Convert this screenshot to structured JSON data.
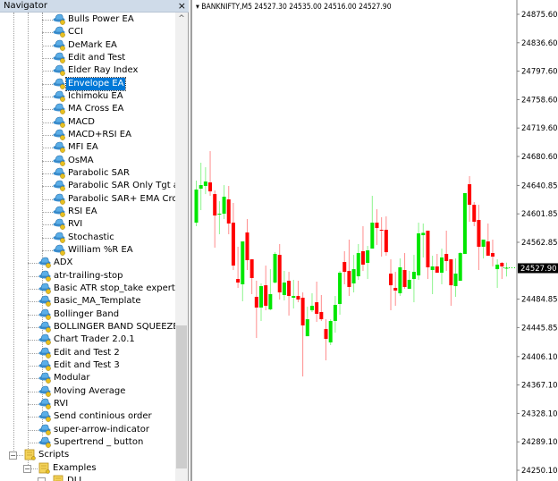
{
  "navigator": {
    "title": "Navigator",
    "close": "×",
    "scroll_up": "^",
    "scroll_position": 0.85,
    "deep_items": [
      "Bulls Power EA",
      "CCI",
      "DeMark EA",
      "Edit and Test",
      "Elder Ray Index",
      "Envelope EA",
      "Ichimoku EA",
      "MA Cross EA",
      "MACD",
      "MACD+RSI EA",
      "MFI EA",
      "OsMA",
      "Parabolic SAR",
      "Parabolic SAR Only Tgt and",
      "Parabolic SAR+ EMA Cross",
      "RSI EA",
      "RVI",
      "Stochastic",
      "William %R EA"
    ],
    "selected": "Envelope EA",
    "items": [
      "ADX",
      "atr-trailing-stop",
      "Basic ATR stop_take expert advi",
      "Basic_MA_Template",
      "Bollinger Band",
      "BOLLINGER BAND SQUEEZE",
      "Chart Trader 2.0.1",
      "Edit and Test 2",
      "Edit and Test 3",
      "Modular",
      "Moving Average",
      "RVI",
      "Send continious order",
      "super-arrow-indicator",
      "Supertrend _ button"
    ],
    "folders": [
      {
        "label": "Scripts",
        "icon": "scroll-icon"
      },
      {
        "label": "Examples",
        "icon": "scroll-icon"
      },
      {
        "label": "DLL",
        "icon": "scroll-icon"
      }
    ],
    "item_icon": "expert-advisor-hat-icon"
  },
  "chart": {
    "header": "BANKNIFTY,M5  24527.30 24535.00 24516.00 24527.90",
    "bull_color": "#00e600",
    "bear_color": "#ff0000",
    "last_price_label": "24527.90"
  },
  "chart_data": {
    "type": "candlestick",
    "symbol": "BANKNIFTY",
    "timeframe": "M5",
    "ylim": [
      24250.1,
      24875.6
    ],
    "y_ticks": [
      "24875.60",
      "24836.60",
      "24797.60",
      "24758.60",
      "24719.60",
      "24680.60",
      "24640.85",
      "24601.85",
      "24562.85",
      "24484.85",
      "24445.85",
      "24406.10",
      "24367.10",
      "24328.10",
      "24289.10",
      "24250.10"
    ],
    "ohlc": [
      [
        24589.8,
        24647.4,
        24584.9,
        24635.2
      ],
      [
        24636.4,
        24672.0,
        24607.0,
        24641.3
      ],
      [
        24640.1,
        24665.8,
        24629.0,
        24646.2
      ],
      [
        24645.0,
        24687.9,
        24626.6,
        24632.7
      ],
      [
        24629.0,
        24634.0,
        24555.5,
        24599.6
      ],
      [
        24600.8,
        24619.2,
        24573.9,
        24602.1
      ],
      [
        24602.1,
        24641.3,
        24594.7,
        24625.4
      ],
      [
        24621.7,
        24640.1,
        24573.9,
        24588.6
      ],
      [
        24589.8,
        24616.8,
        24524.8,
        24530.9
      ],
      [
        24512.5,
        24556.7,
        24500.3,
        24507.6
      ],
      [
        24505.2,
        24564.0,
        24481.9,
        24564.0
      ],
      [
        24576.3,
        24594.7,
        24524.8,
        24538.3
      ],
      [
        24539.5,
        24539.5,
        24491.7,
        24513.8
      ],
      [
        24488.0,
        24510.1,
        24431.6,
        24473.3
      ],
      [
        24473.3,
        24506.4,
        24454.9,
        24502.7
      ],
      [
        24503.9,
        24530.9,
        24469.6,
        24475.7
      ],
      [
        24470.8,
        24526.0,
        24469.6,
        24491.7
      ],
      [
        24507.6,
        24549.3,
        24506.4,
        24546.9
      ],
      [
        24545.6,
        24560.4,
        24484.3,
        24494.1
      ],
      [
        24490.5,
        24523.6,
        24483.1,
        24507.6
      ],
      [
        24510.1,
        24522.3,
        24462.3,
        24489.2
      ],
      [
        24486.8,
        24511.3,
        24472.1,
        24489.2
      ],
      [
        24489.2,
        24510.1,
        24480.6,
        24484.3
      ],
      [
        24486.8,
        24494.1,
        24378.8,
        24448.8
      ],
      [
        24434.0,
        24474.5,
        24434.0,
        24457.3
      ],
      [
        24469.6,
        24492.9,
        24467.2,
        24475.7
      ],
      [
        24480.6,
        24508.9,
        24453.7,
        24464.7
      ],
      [
        24467.2,
        24490.5,
        24454.9,
        24457.3
      ],
      [
        24443.8,
        24457.3,
        24400.9,
        24430.4
      ],
      [
        24425.5,
        24457.3,
        24421.8,
        24454.9
      ],
      [
        24454.9,
        24489.2,
        24438.9,
        24477.0
      ],
      [
        24478.2,
        24523.6,
        24463.5,
        24521.1
      ],
      [
        24535.8,
        24550.6,
        24505.2,
        24522.3
      ],
      [
        24523.6,
        24566.5,
        24489.2,
        24501.5
      ],
      [
        24506.4,
        24545.6,
        24494.1,
        24526.0
      ],
      [
        24516.2,
        24560.4,
        24511.3,
        24548.1
      ],
      [
        24550.6,
        24584.9,
        24523.6,
        24532.2
      ],
      [
        24534.6,
        24557.9,
        24512.5,
        24551.8
      ],
      [
        24554.2,
        24626.6,
        24554.2,
        24589.8
      ],
      [
        24589.8,
        24608.2,
        24559.1,
        24582.4
      ],
      [
        24580.0,
        24597.2,
        24543.2,
        24578.8
      ],
      [
        24580.0,
        24598.4,
        24544.4,
        24549.3
      ],
      [
        24519.9,
        24539.5,
        24469.6,
        24503.9
      ],
      [
        24500.3,
        24522.3,
        24475.7,
        24496.6
      ],
      [
        24492.9,
        24540.7,
        24489.2,
        24528.5
      ],
      [
        24524.8,
        24548.1,
        24499.0,
        24501.5
      ],
      [
        24499.0,
        24523.6,
        24499.0,
        24511.3
      ],
      [
        24512.5,
        24545.6,
        24480.6,
        24522.3
      ],
      [
        24517.4,
        24589.8,
        24511.3,
        24575.1
      ],
      [
        24572.6,
        24588.6,
        24542.0,
        24575.8
      ],
      [
        24578.8,
        24578.8,
        24512.5,
        24528.5
      ],
      [
        24524.8,
        24544.4,
        24491.7,
        24529.7
      ],
      [
        24529.7,
        24546.9,
        24521.1,
        24521.1
      ],
      [
        24521.1,
        24554.2,
        24505.2,
        24542.0
      ],
      [
        24546.9,
        24578.8,
        24523.6,
        24537.1
      ],
      [
        24539.5,
        24539.5,
        24475.7,
        24503.9
      ],
      [
        24502.7,
        24540.7,
        24488.0,
        24519.9
      ],
      [
        24510.1,
        24549.3,
        24510.1,
        24548.1
      ],
      [
        24546.9,
        24630.3,
        24546.9,
        24630.3
      ],
      [
        24642.5,
        24653.6,
        24591.0,
        24614.3
      ],
      [
        24614.3,
        24618.0,
        24584.9,
        24591.0
      ],
      [
        24593.5,
        24614.3,
        24524.8,
        24556.7
      ],
      [
        24556.7,
        24566.5,
        24540.7,
        24566.5
      ],
      [
        24564.0,
        24588.6,
        24544.4,
        24544.4
      ],
      [
        24548.1,
        24566.5,
        24529.7,
        24543.2
      ],
      [
        24526.0,
        24539.5,
        24500.3,
        24532.2
      ],
      [
        24534.6,
        24535.8,
        24512.5,
        24529.7
      ],
      [
        24527.3,
        24535.0,
        24516.0,
        24527.9
      ]
    ]
  }
}
